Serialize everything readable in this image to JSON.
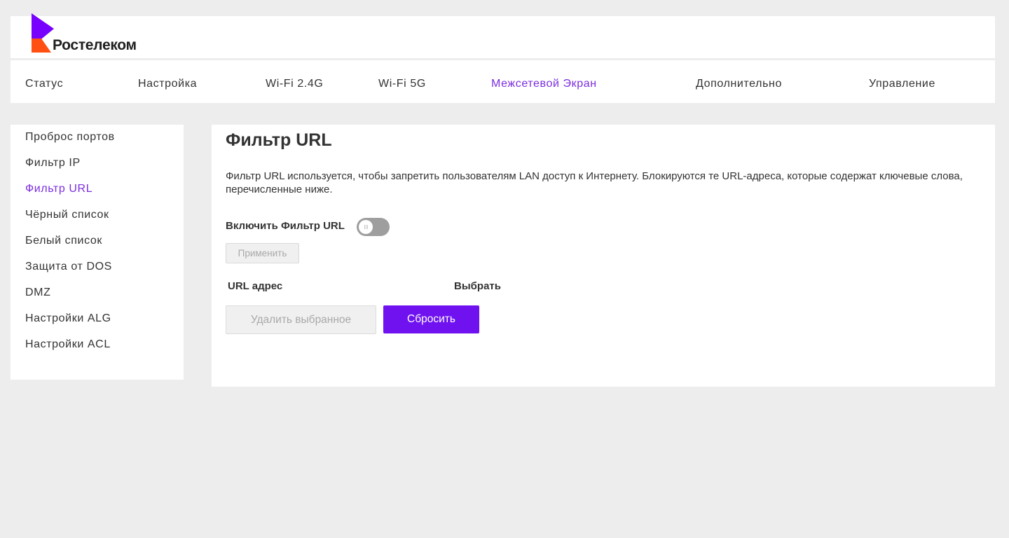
{
  "brand": {
    "name": "Ростелеком",
    "logo_colors": {
      "primary": "#7700ff",
      "accent": "#ff4f12"
    }
  },
  "topnav": {
    "items": [
      {
        "label": "Статус"
      },
      {
        "label": "Настройка"
      },
      {
        "label": "Wi-Fi 2.4G"
      },
      {
        "label": "Wi-Fi 5G"
      },
      {
        "label": "Межсетевой Экран",
        "active": true
      },
      {
        "label": "Дополнительно"
      },
      {
        "label": "Управление"
      }
    ]
  },
  "sidebar": {
    "items": [
      {
        "label": "Проброс портов"
      },
      {
        "label": "Фильтр IP"
      },
      {
        "label": "Фильтр URL",
        "active": true
      },
      {
        "label": "Чёрный список"
      },
      {
        "label": "Белый список"
      },
      {
        "label": "Защита от DOS"
      },
      {
        "label": "DMZ"
      },
      {
        "label": "Настройки ALG"
      },
      {
        "label": "Настройки ACL"
      }
    ]
  },
  "main": {
    "title": "Фильтр URL",
    "description": "Фильтр URL используется, чтобы запретить пользователям LAN доступ к Интернету. Блокируются те URL-адреса, которые содержат ключевые слова, перечисленные ниже.",
    "enable_label": "Включить Фильтр URL",
    "enable_state": "off",
    "apply_label": "Применить",
    "table_headers": [
      "URL адрес",
      "Выбрать"
    ],
    "delete_selected_label": "Удалить выбранное",
    "reset_label": "Сбросить"
  },
  "colors": {
    "accent": "#7b2ee0",
    "button_primary": "#7012f0",
    "background": "#ededed"
  }
}
